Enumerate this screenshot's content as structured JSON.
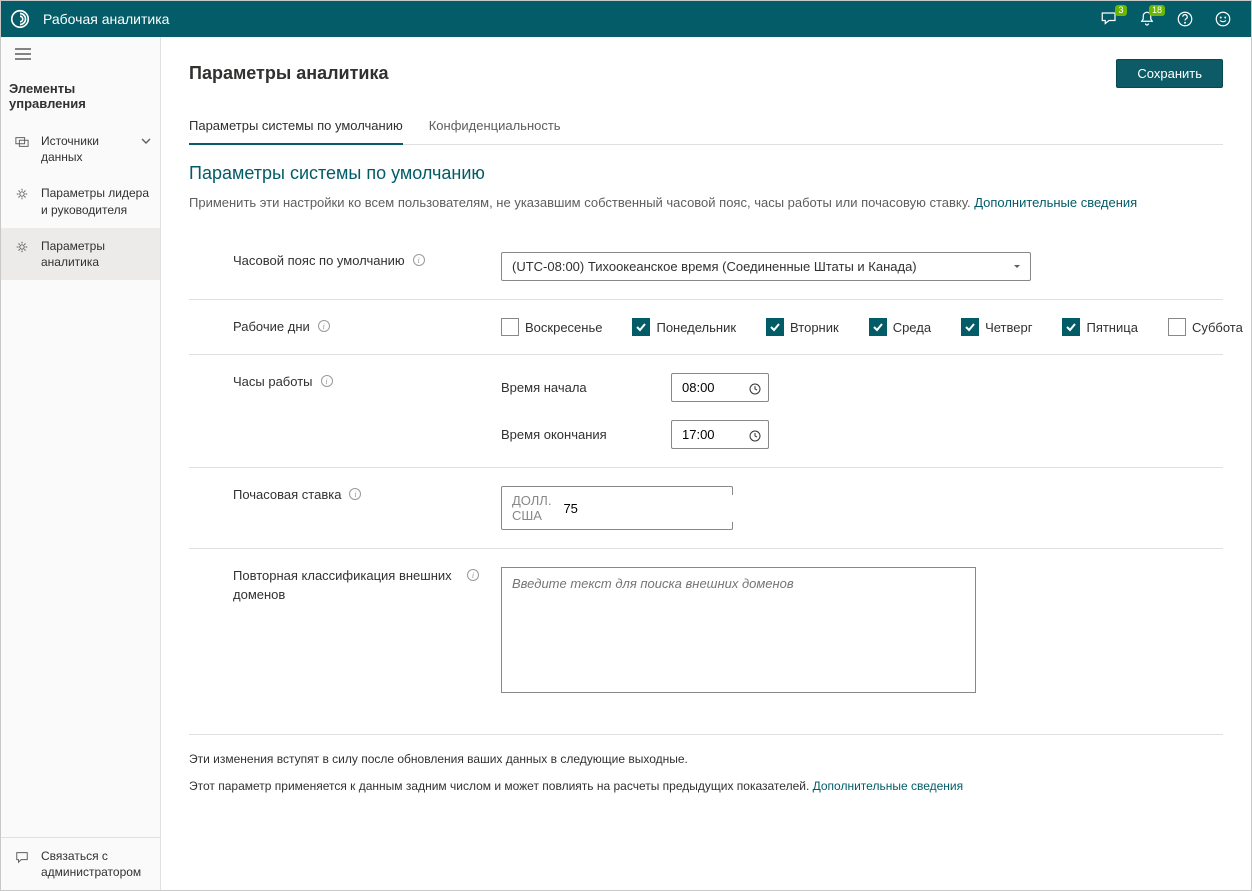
{
  "header": {
    "app_title": "Рабочая аналитика",
    "badge_feedback": "3",
    "badge_bell": "18"
  },
  "sidebar": {
    "section_label": "Элементы управления",
    "items": [
      {
        "label": "Источники данных"
      },
      {
        "label": "Параметры лидера и руководителя"
      },
      {
        "label": "Параметры аналитика"
      }
    ],
    "footer_label": "Связаться с администратором"
  },
  "page": {
    "title": "Параметры аналитика",
    "save_label": "Сохранить"
  },
  "tabs": [
    {
      "label": "Параметры системы по умолчанию"
    },
    {
      "label": "Конфиденциальность"
    }
  ],
  "section": {
    "title": "Параметры системы по умолчанию",
    "desc_text": "Применить эти настройки ко всем пользователям, не указавшим собственный часовой пояс, часы работы или почасовую ставку. ",
    "desc_link": "Дополнительные сведения"
  },
  "fields": {
    "timezone": {
      "label": "Часовой пояс по умолчанию",
      "value": "(UTC-08:00) Тихоокеанское время (Соединенные Штаты и Канада)"
    },
    "workdays": {
      "label": "Рабочие дни",
      "days": [
        {
          "label": "Воскресенье",
          "checked": false
        },
        {
          "label": "Понедельник",
          "checked": true
        },
        {
          "label": "Вторник",
          "checked": true
        },
        {
          "label": "Среда",
          "checked": true
        },
        {
          "label": "Четверг",
          "checked": true
        },
        {
          "label": "Пятница",
          "checked": true
        },
        {
          "label": "Суббота",
          "checked": false
        }
      ]
    },
    "workhours": {
      "label": "Часы работы",
      "start_label": "Время начала",
      "start_value": "08:00",
      "end_label": "Время окончания",
      "end_value": "17:00"
    },
    "rate": {
      "label": "Почасовая ставка",
      "currency": "ДОЛЛ. США",
      "value": "75"
    },
    "domains": {
      "label": "Повторная классификация внешних доменов",
      "placeholder": "Введите текст для поиска внешних доменов"
    }
  },
  "footer": {
    "note1": "Эти изменения вступят в силу после обновления ваших данных в следующие выходные.",
    "note2_text": "Этот параметр применяется к данным задним числом и может повлиять на расчеты предыдущих показателей. ",
    "note2_link": "Дополнительные сведения"
  }
}
